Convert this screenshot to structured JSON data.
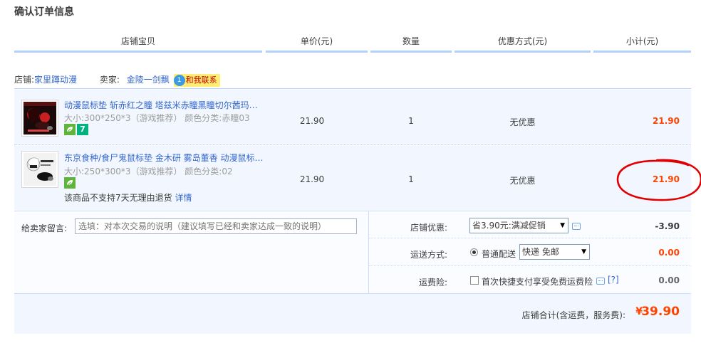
{
  "page_title": "确认订单信息",
  "columns": {
    "item": "店铺宝贝",
    "price": "单价(元)",
    "qty": "数量",
    "discount": "优惠方式(元)",
    "subtotal": "小计(元)"
  },
  "shop": {
    "label": "店铺:",
    "name": "家里蹲动漫",
    "seller_label": "卖家:",
    "seller_name": "金陵一剑飘",
    "chat_label": "和我联系",
    "chat_badge": "1"
  },
  "items": [
    {
      "title": "动漫鼠标垫 斩赤红之瞳 塔兹米赤瞳黑瞳切尔茜玛…",
      "sku": "大小:300*250*3（游戏推荐）   颜色分类:赤瞳03",
      "price": "21.90",
      "qty": "1",
      "discount": "无优惠",
      "subtotal": "21.90",
      "badges": [
        "green-leaf-icon",
        "seven-day-icon"
      ],
      "seven_label": "7"
    },
    {
      "title": "东京食种/食尸鬼鼠标垫 金木研 雾岛董香 动漫鼠标…",
      "sku": "大小:250*300*3（游戏推荐）   颜色分类:02",
      "price": "21.90",
      "qty": "1",
      "discount": "无优惠",
      "subtotal": "21.90",
      "badges": [
        "green-leaf-icon"
      ],
      "notice": "该商品不支持7天无理由退货",
      "notice_link": "详情"
    }
  ],
  "message": {
    "label": "给卖家留言:",
    "placeholder": "选填：对本次交易的说明（建议填写已经和卖家达成一致的说明）"
  },
  "shop_discount": {
    "label": "店铺优惠:",
    "selected": "省3.90元:满减促销",
    "value": "-3.90"
  },
  "shipping": {
    "label": "运送方式:",
    "option": "普通配送",
    "selected": "快递 免邮",
    "value": "0.00"
  },
  "insurance": {
    "label": "运费险:",
    "option": "首次快捷支付享受免费运费险",
    "help": "[?]",
    "value": "0.00"
  },
  "total": {
    "label": "店铺合计(含运费，服务费):",
    "currency": "¥",
    "value": "39.90"
  },
  "colors": {
    "accent_blue": "#3366cc",
    "price_orange": "#ff4400",
    "header_line": "#b2d1ff",
    "row_bg": "#f2f7ff",
    "annotation_red": "#e00000"
  }
}
